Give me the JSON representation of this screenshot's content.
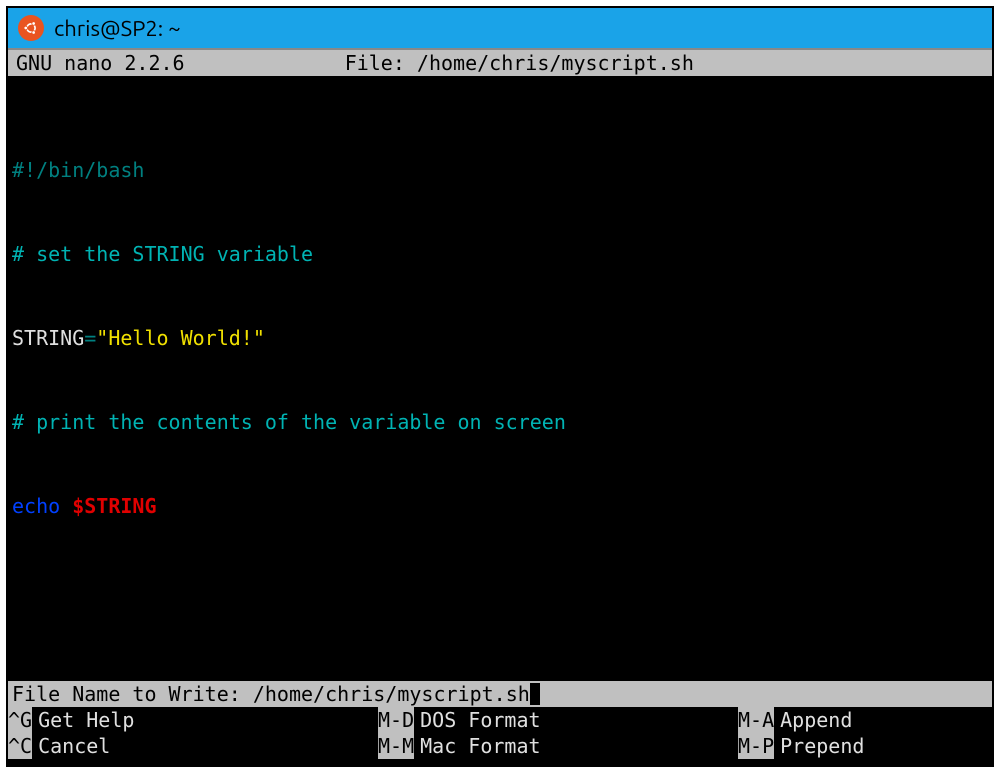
{
  "titlebar": {
    "title": "chris@SP2: ~"
  },
  "nano": {
    "version": " GNU nano 2.2.6",
    "file_label": "File: /home/chris/myscript.sh"
  },
  "code": {
    "line1": "#!/bin/bash",
    "line2": "# set the STRING variable",
    "line3a": "STRING",
    "line3b": "=",
    "line3c": "\"Hello World!\"",
    "line4": "# print the contents of the variable on screen",
    "line5a": "echo",
    "line5b": " ",
    "line5c": "$STRING"
  },
  "prompt": {
    "label": "File Name to Write: ",
    "value": "/home/chris/myscript.sh"
  },
  "shortcuts": {
    "row1": [
      {
        "key": "^G",
        "label": "Get Help"
      },
      {
        "key": "M-D",
        "label": "DOS Format"
      },
      {
        "key": "M-A",
        "label": "Append"
      }
    ],
    "row2": [
      {
        "key": "^C",
        "label": "Cancel"
      },
      {
        "key": "M-M",
        "label": "Mac Format"
      },
      {
        "key": "M-P",
        "label": "Prepend"
      }
    ]
  }
}
